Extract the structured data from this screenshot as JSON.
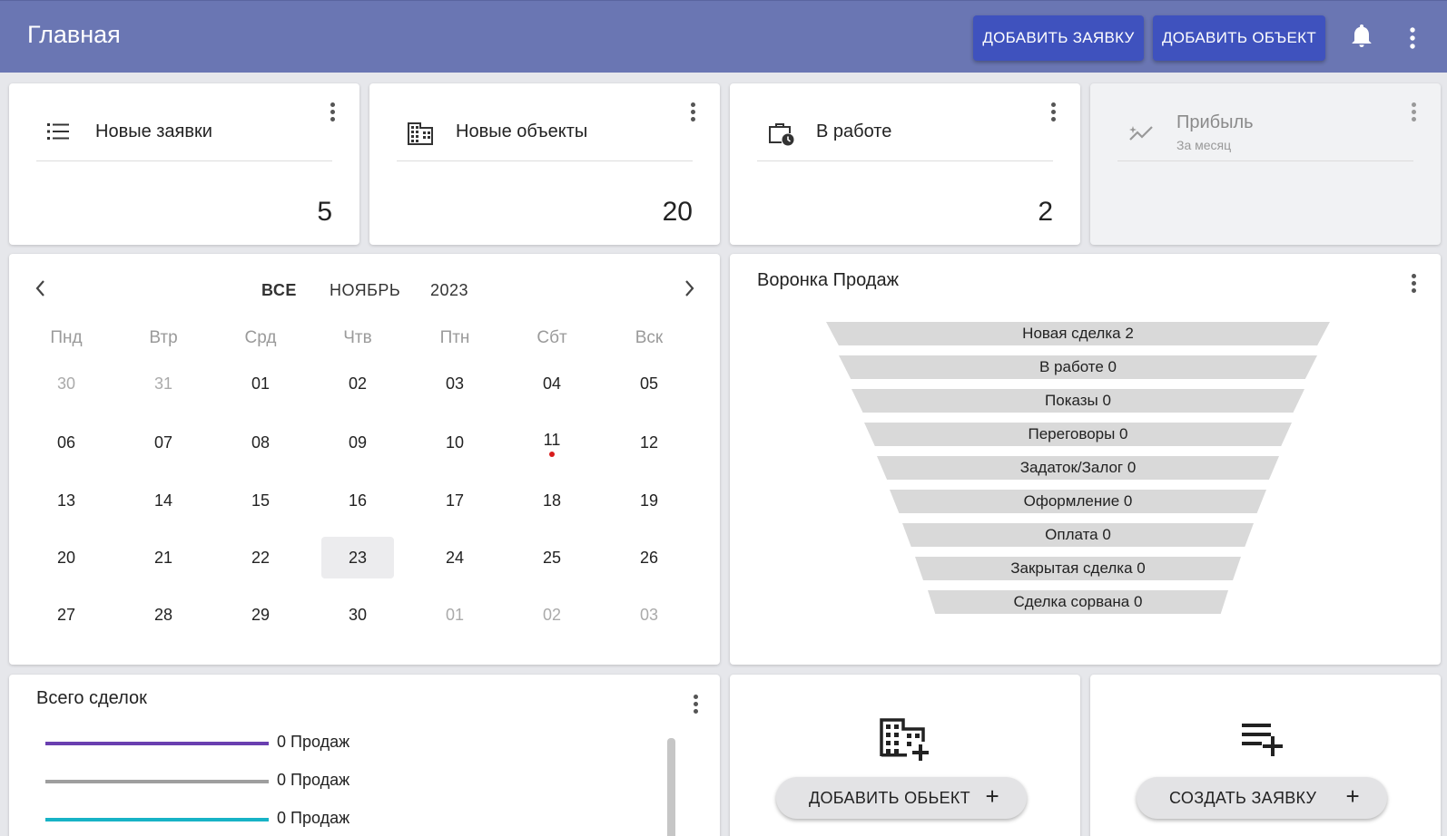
{
  "header": {
    "title": "Главная",
    "add_request_label": "ДОБАВИТЬ ЗАЯВКУ",
    "add_object_label": "ДОБАВИТЬ ОБЪЕКТ",
    "bell_icon": "bell-icon",
    "menu_icon": "more-vert-icon"
  },
  "stats": [
    {
      "label": "Новые заявки",
      "value": "5",
      "icon": "list-icon"
    },
    {
      "label": "Новые объекты",
      "value": "20",
      "icon": "building-icon"
    },
    {
      "label": "В работе",
      "value": "2",
      "icon": "briefcase-clock-icon"
    },
    {
      "label": "Прибыль",
      "sublabel": "За месяц",
      "icon": "trending-icon"
    }
  ],
  "calendar": {
    "filter": "ВСЕ",
    "month": "НОЯБРЬ",
    "year": "2023",
    "weekdays": [
      "Пнд",
      "Втр",
      "Срд",
      "Чтв",
      "Птн",
      "Сбт",
      "Вск"
    ],
    "weeks": [
      [
        "30",
        "31",
        "01",
        "02",
        "03",
        "04",
        "05"
      ],
      [
        "06",
        "07",
        "08",
        "09",
        "10",
        "11",
        "12"
      ],
      [
        "13",
        "14",
        "15",
        "16",
        "17",
        "18",
        "19"
      ],
      [
        "20",
        "21",
        "22",
        "23",
        "24",
        "25",
        "26"
      ],
      [
        "27",
        "28",
        "29",
        "30",
        "01",
        "02",
        "03"
      ]
    ],
    "today": "23",
    "event_day": "11"
  },
  "funnel": {
    "title": "Воронка Продаж",
    "stages": [
      "Новая сделка 2",
      "В работе 0",
      "Показы 0",
      "Переговоры 0",
      "Задаток/Залог 0",
      "Оформление 0",
      "Оплата 0",
      "Закрытая сделка 0",
      "Сделка сорвана 0"
    ]
  },
  "deals": {
    "title": "Всего сделок",
    "series": [
      {
        "label": "0 Продаж",
        "color": "#6a3fb0"
      },
      {
        "label": "0 Продаж",
        "color": "#9e9e9e"
      },
      {
        "label": "0 Продаж",
        "color": "#17b3c6"
      }
    ]
  },
  "actions": {
    "add_object_label": "ДОБАВИТЬ ОБЬЕКТ",
    "create_request_label": "СОЗДАТЬ ЗАЯВКУ",
    "plus": "+"
  }
}
